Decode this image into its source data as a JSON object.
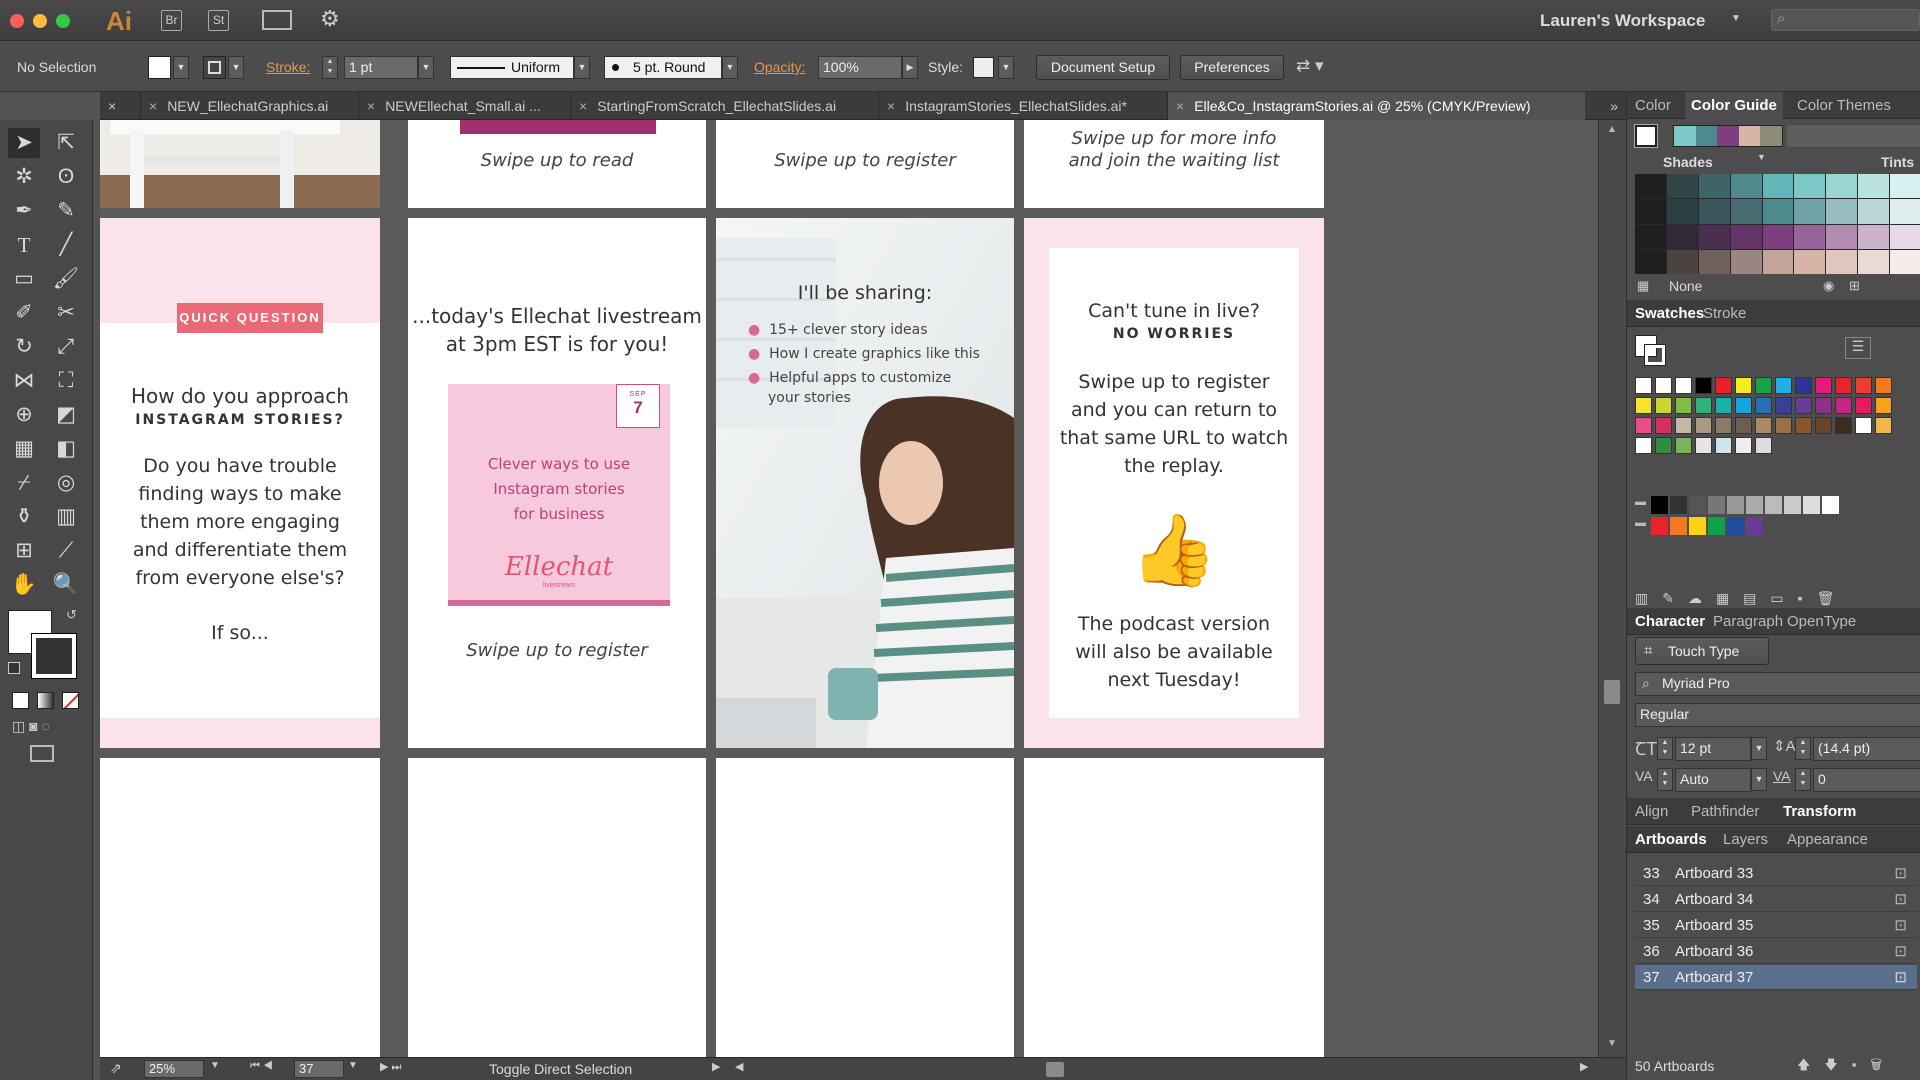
{
  "app": {
    "logo": "Ai",
    "bridge": "Br",
    "stock": "St",
    "workspace": "Lauren's Workspace"
  },
  "controlbar": {
    "selection": "No Selection",
    "stroke_label": "Stroke:",
    "stroke_value": "1 pt",
    "profile": "Uniform",
    "brush": "5 pt. Round",
    "opacity_label": "Opacity:",
    "opacity_value": "100%",
    "style_label": "Style:",
    "document_setup": "Document Setup",
    "preferences": "Preferences"
  },
  "tabs": [
    {
      "label": "NEW_EllechatGraphics.ai"
    },
    {
      "label": "NEWEllechat_Small.ai ..."
    },
    {
      "label": "StartingFromScratch_EllechatSlides.ai"
    },
    {
      "label": "InstagramStories_EllechatSlides.ai*"
    },
    {
      "label": "Elle&Co_InstagramStories.ai @ 25% (CMYK/Preview)"
    }
  ],
  "artboards": {
    "top2": "Swipe up to read",
    "top3": "Swipe up to register",
    "top4_line1": "Swipe up for more info",
    "top4_line2": "and join the waiting list",
    "a1": {
      "badge": "QUICK QUESTION",
      "q_line1": "How do you approach",
      "q_line2": "INSTAGRAM STORIES?",
      "body": [
        "Do you have trouble",
        "finding ways to make",
        "them more engaging",
        "and differentiate them",
        "from everyone else's?"
      ],
      "ending": "If so..."
    },
    "a2": {
      "line1": "...today's Ellechat livestream",
      "line2": "at 3pm EST is for you!",
      "month": "SEP",
      "day": "7",
      "card": [
        "Clever ways to use",
        "Instagram stories",
        "for business"
      ],
      "brand": "Ellechat",
      "brand_sub": "livestream",
      "cta": "Swipe up to register"
    },
    "a3": {
      "heading": "I'll be sharing:",
      "bullets": [
        "15+ clever story ideas",
        "How I create graphics like this",
        "Helpful apps to customize",
        "your stories"
      ]
    },
    "a4": {
      "line1": "Can't tune in live?",
      "line2": "NO WORRIES",
      "body": [
        "Swipe up to register",
        "and you can return to",
        "that same URL to watch",
        "the replay."
      ],
      "footer": [
        "The podcast version",
        "will also be available",
        "next Tuesday!"
      ]
    }
  },
  "statusbar": {
    "zoom": "25%",
    "page": "37",
    "status": "Toggle Direct Selection"
  },
  "panels": {
    "color_tabs": [
      "Color",
      "Color Guide",
      "Color Themes"
    ],
    "shades": "Shades",
    "tints": "Tints",
    "none": "None",
    "swatch_tabs": [
      "Swatches",
      "Stroke"
    ],
    "char_tabs": [
      "Character",
      "Paragraph",
      "OpenType"
    ],
    "touch_type": "Touch Type Tool",
    "font": "Myriad Pro",
    "font_style": "Regular",
    "font_size": "12 pt",
    "leading": "(14.4 pt)",
    "kerning": "Auto",
    "tracking": "0",
    "align_tabs": [
      "Align",
      "Pathfinder",
      "Transform"
    ],
    "ab_tabs": [
      "Artboards",
      "Layers",
      "Appearance"
    ],
    "artboard_rows": [
      {
        "num": "33",
        "name": "Artboard 33"
      },
      {
        "num": "34",
        "name": "Artboard 34"
      },
      {
        "num": "35",
        "name": "Artboard 35"
      },
      {
        "num": "36",
        "name": "Artboard 36"
      },
      {
        "num": "37",
        "name": "Artboard 37"
      }
    ],
    "artboard_count": "50 Artboards"
  },
  "colors": {
    "accent_pink": "#e96a77",
    "light_pink": "#fbe3ec",
    "card_pink": "#f6c9dd",
    "plum": "#a2306f"
  }
}
